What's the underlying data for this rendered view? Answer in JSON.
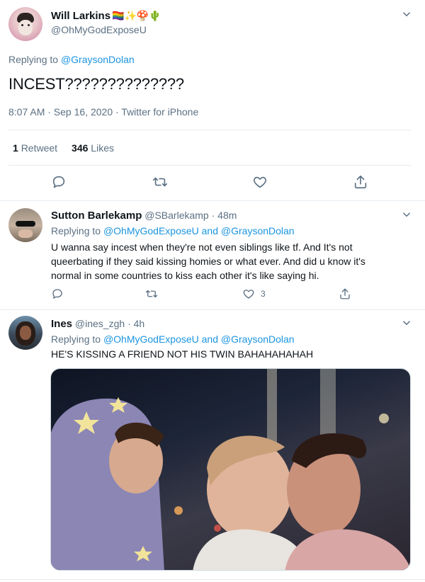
{
  "main_tweet": {
    "author_name": "Will Larkins",
    "author_emojis": "🏳️‍🌈✨🍄🌵",
    "author_handle": "@OhMyGodExposeU",
    "replying_prefix": "Replying to",
    "replying_to": "@GraysonDolan",
    "text": "INCEST??????????????",
    "timestamp": "8:07 AM · Sep 16, 2020 · Twitter for iPhone",
    "retweet_count": "1",
    "retweet_label": "Retweet",
    "like_count": "346",
    "like_label": "Likes"
  },
  "reply1": {
    "author_name": "Sutton Barlekamp",
    "author_handle": "@SBarlekamp",
    "time": "· 48m",
    "replying_prefix": "Replying to",
    "replying_to": "@OhMyGodExposeU and @GraysonDolan",
    "text": "U wanna say incest when they're not even siblings like tf. And It's not queerbating if they said kissing homies or what ever. And did u know it's normal in some countries to kiss each other it's like saying hi.",
    "like_count": "3"
  },
  "reply2": {
    "author_name": "Ines",
    "author_handle": "@ines_zgh",
    "time": "· 4h",
    "replying_prefix": "Replying to",
    "replying_to": "@OhMyGodExposeU and @GraysonDolan",
    "text": "HE'S KISSING A FRIEND NOT HIS TWIN BAHAHAHAHAH"
  },
  "icons": [
    "reply-icon",
    "retweet-icon",
    "like-icon",
    "share-icon",
    "chevron-down-icon"
  ],
  "colors": {
    "link": "#1b95e0",
    "muted": "#5b7083",
    "divider": "#e6ecf0"
  }
}
